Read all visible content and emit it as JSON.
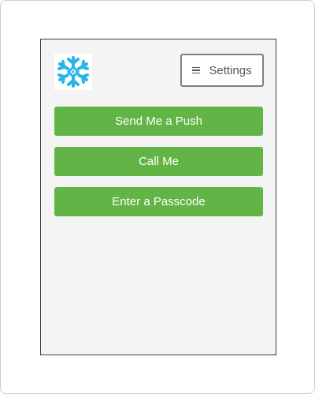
{
  "header": {
    "logo_icon": "snowflake-icon",
    "logo_color": "#29b5e8",
    "settings_icon": "hamburger-menu-icon",
    "settings_label": "Settings"
  },
  "actions": [
    {
      "label": "Send Me a Push"
    },
    {
      "label": "Call Me"
    },
    {
      "label": "Enter a Passcode"
    }
  ],
  "colors": {
    "primary_button": "#62b446",
    "panel_background": "#f4f4f4",
    "panel_border": "#2b3f57"
  }
}
